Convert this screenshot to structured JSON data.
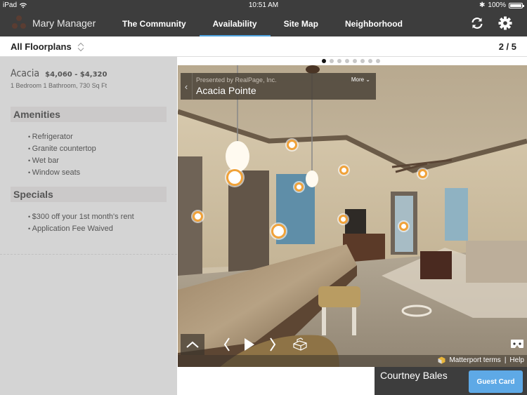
{
  "status_bar": {
    "device": "iPad",
    "time": "10:51 AM",
    "battery": "100%",
    "battery_level": 1.0
  },
  "nav": {
    "user_name": "Mary Manager",
    "tabs": [
      {
        "label": "The Community",
        "active": false
      },
      {
        "label": "Availability",
        "active": true
      },
      {
        "label": "Site Map",
        "active": false
      },
      {
        "label": "Neighborhood",
        "active": false
      }
    ],
    "icons": [
      "refresh-icon",
      "gear-icon"
    ]
  },
  "subheader": {
    "floorplan_filter": "All Floorplans",
    "page_counter": "2 / 5"
  },
  "floorplan": {
    "name": "Acacia",
    "price": "$4,060 - $4,320",
    "description": "1 Bedroom 1 Bathroom, 730 Sq Ft",
    "amenities_title": "Amenities",
    "amenities": [
      "Refrigerator",
      "Granite countertop",
      "Wet bar",
      "Window seats"
    ],
    "specials_title": "Specials",
    "specials": [
      "$300 off your 1st month's rent",
      "Application Fee Waived"
    ]
  },
  "tour": {
    "slide_count": 8,
    "active_slide": 1,
    "presented_by": "Presented by RealPage, Inc.",
    "title": "Acacia Pointe",
    "more_label": "More",
    "terms_label": "Matterport terms",
    "separator": "|",
    "help_label": "Help",
    "hotspot_color": "#f0a23a"
  },
  "guest": {
    "name": "Courtney Bales",
    "button_label": "Guest Card",
    "button_color": "#5ea9e6"
  }
}
